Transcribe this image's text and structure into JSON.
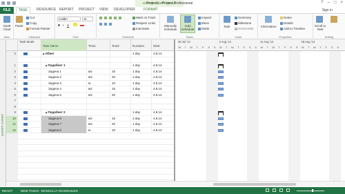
{
  "window": {
    "title": "Project1 - Project Professional",
    "context_tab_group": "GANTT CHART TOOLS",
    "sign_in": "Sign in",
    "controls": [
      "?",
      "–",
      "□",
      "×"
    ]
  },
  "tabs": [
    "FILE",
    "TASK",
    "RESOURCE",
    "REPORT",
    "PROJECT",
    "VIEW",
    "DEVELOPER",
    "FORMAT"
  ],
  "active_tab": "TASK",
  "ribbon": {
    "view": {
      "button": "Gantt Chart",
      "label": "View"
    },
    "clipboard": {
      "paste": "Paste",
      "cut": "Cut",
      "copy": "Copy",
      "format_painter": "Format Painter",
      "label": "Clipboard"
    },
    "font": {
      "family": "Calibri",
      "size": "11",
      "bold": "B",
      "italic": "I",
      "underline": "U",
      "label": "Font"
    },
    "schedule": {
      "mark_on_track": "Mark on Track",
      "respect_links": "Respect Links",
      "inactivate": "Inactivate",
      "label": "Schedule"
    },
    "tasks": {
      "manually": "Manually Schedule",
      "auto": "Auto Schedule",
      "inspect": "Inspect",
      "move": "Move",
      "mode": "Mode",
      "label": "Tasks"
    },
    "insert": {
      "task": "Task",
      "summary": "Summary",
      "milestone": "Milestone",
      "deliverable": "Deliverable",
      "label": "Insert"
    },
    "properties": {
      "information": "Information",
      "notes": "Notes",
      "details": "Details",
      "add_to_timeline": "Add to Timeline",
      "label": "Properties"
    },
    "editing": {
      "scroll_to_task": "Scroll to Task",
      "label": "Editing"
    }
  },
  "sidebar_label": "GANTT CHART",
  "grid": {
    "columns": [
      "",
      "Task Mode",
      "Task Name",
      "Text1",
      "Text2",
      "Duration",
      "Start"
    ],
    "rows": [
      {
        "id": "0",
        "name": "Обект",
        "text1": "",
        "text2": "",
        "duration": "1 day",
        "start": "4.8.14",
        "summary": true,
        "indent": 0
      },
      {
        "id": "",
        "name": "",
        "text1": "",
        "text2": "",
        "duration": "",
        "start": "",
        "blank": true
      },
      {
        "id": "1",
        "name": "Подобект 1",
        "text1": "",
        "text2": "",
        "duration": "1 day",
        "start": "4.8.14",
        "summary": true,
        "indent": 1
      },
      {
        "id": "2",
        "name": "Задача 1",
        "text1": "м2",
        "text2": "15",
        "duration": "1 day",
        "start": "4.8.14",
        "indent": 2
      },
      {
        "id": "3",
        "name": "Задача 2",
        "text1": "м3",
        "text2": "20",
        "duration": "1 day",
        "start": "4.8.14",
        "indent": 2
      },
      {
        "id": "4",
        "name": "Задача 3",
        "text1": "м",
        "text2": "10",
        "duration": "1 day",
        "start": "4.8.14",
        "indent": 2
      },
      {
        "id": "5",
        "name": "Задача 4",
        "text1": "м2",
        "text2": "15",
        "duration": "1 day",
        "start": "4.8.14",
        "indent": 2
      },
      {
        "id": "6",
        "name": "Задача 5",
        "text1": "м3",
        "text2": "20",
        "duration": "1 day",
        "start": "4.8.14",
        "indent": 2
      },
      {
        "id": "7",
        "name": "",
        "text1": "",
        "text2": "",
        "duration": "",
        "start": "",
        "blank": true
      },
      {
        "id": "8",
        "name": "",
        "text1": "",
        "text2": "",
        "duration": "",
        "start": "",
        "blank": true
      },
      {
        "id": "9",
        "name": "Подобект 2",
        "text1": "",
        "text2": "",
        "duration": "1 day",
        "start": "4.8.14",
        "summary": true,
        "indent": 1
      },
      {
        "id": "10",
        "name": "Задача 6",
        "text1": "м2",
        "text2": "15",
        "duration": "1 day",
        "start": "4.8.14",
        "indent": 2,
        "selected": true
      },
      {
        "id": "11",
        "name": "Задача 7",
        "text1": "м3",
        "text2": "20",
        "duration": "1 day",
        "start": "4.8.14",
        "indent": 2,
        "selected": true
      },
      {
        "id": "12",
        "name": "Задача 8",
        "text1": "м",
        "text2": "10",
        "duration": "1 day",
        "start": "4.8.14",
        "indent": 2,
        "selected": true
      }
    ]
  },
  "gantt": {
    "weeks": [
      "28 Jul '14",
      "4 Aug '14",
      "11 Aug '14",
      "18 Aug '14"
    ],
    "days": [
      "M",
      "T",
      "W",
      "T",
      "F",
      "S",
      "S",
      "M",
      "T",
      "W",
      "T",
      "F",
      "S",
      "S",
      "M",
      "T",
      "W",
      "T",
      "F",
      "S",
      "S",
      "M",
      "T",
      "W",
      "T",
      "F",
      "S",
      "S"
    ]
  },
  "status": {
    "ready": "READY",
    "mode": "NEW TASKS : MANUALLY SCHEDULED"
  },
  "colors": {
    "accent": "#217346",
    "bar": "#7fa6d6",
    "selected": "#cfe6c4"
  }
}
